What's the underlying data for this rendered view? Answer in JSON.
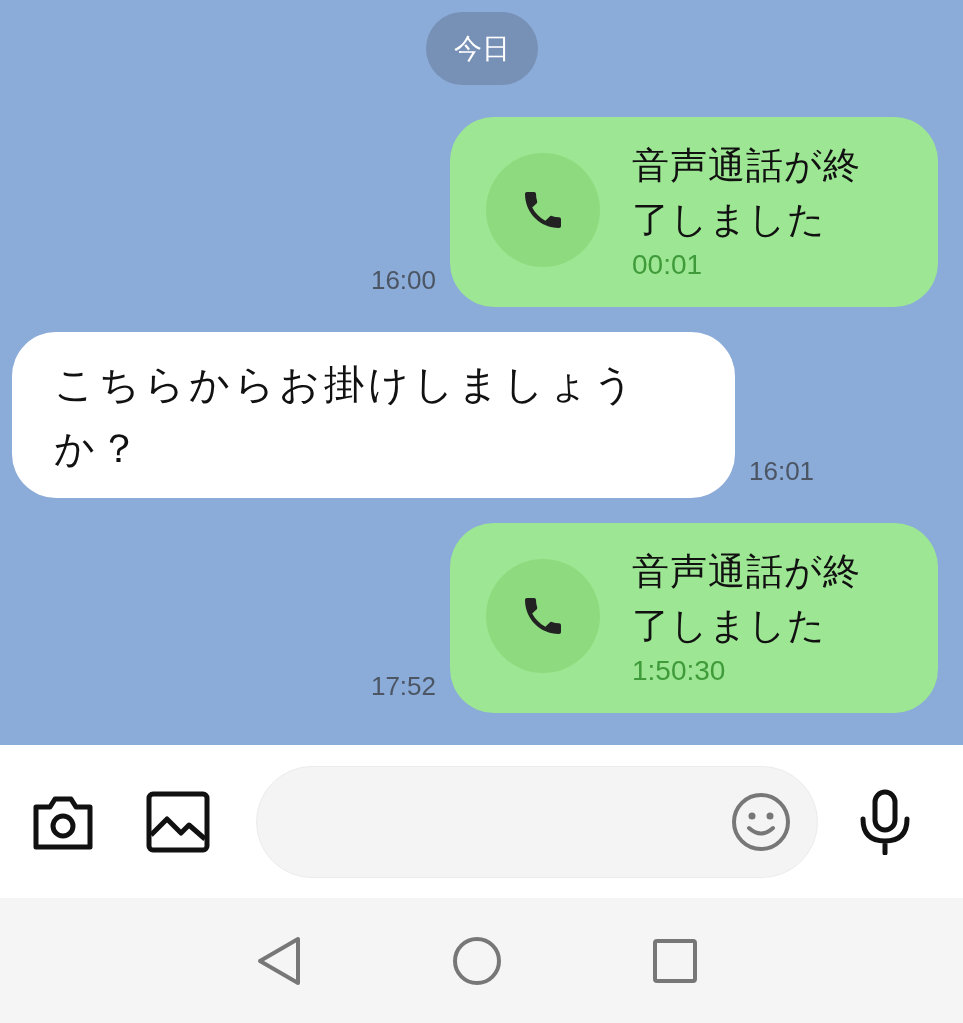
{
  "date_badge": "今日",
  "messages": [
    {
      "kind": "call",
      "outgoing": true,
      "text": "音声通話が終了しました",
      "duration": "00:01",
      "time": "16:00"
    },
    {
      "kind": "text",
      "outgoing": false,
      "text": "こちらからお掛けしましょうか？",
      "time": "16:01"
    },
    {
      "kind": "call",
      "outgoing": true,
      "text": "音声通話が終了しました",
      "duration": "1:50:30",
      "time": "17:52"
    }
  ]
}
